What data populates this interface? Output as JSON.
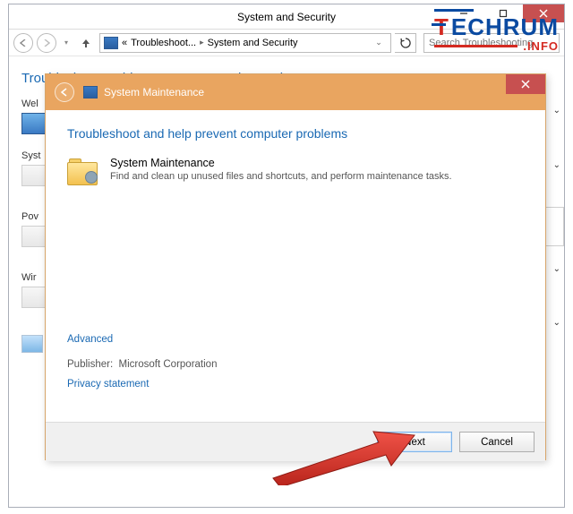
{
  "window": {
    "title": "System and Security",
    "breadcrumb1": "Troubleshoot...",
    "breadcrumb2": "System and Security",
    "search_placeholder": "Search Troubleshooting"
  },
  "page": {
    "heading": "Troubleshoot problems - System and Security",
    "cats": [
      "Web",
      "System",
      "Power",
      "Windows"
    ],
    "cats_short": [
      "Wel",
      "Syst",
      "Pov",
      "Wir"
    ]
  },
  "dialog": {
    "title": "System Maintenance",
    "heading": "Troubleshoot and help prevent computer problems",
    "item_name": "System Maintenance",
    "item_desc": "Find and clean up unused files and shortcuts, and perform maintenance tasks.",
    "advanced": "Advanced",
    "publisher_label": "Publisher:",
    "publisher": "Microsoft Corporation",
    "privacy": "Privacy statement",
    "next": "Next",
    "cancel": "Cancel"
  },
  "logo": {
    "t": "T",
    "rest": "ECHRUM",
    "sub": ".INFO"
  }
}
